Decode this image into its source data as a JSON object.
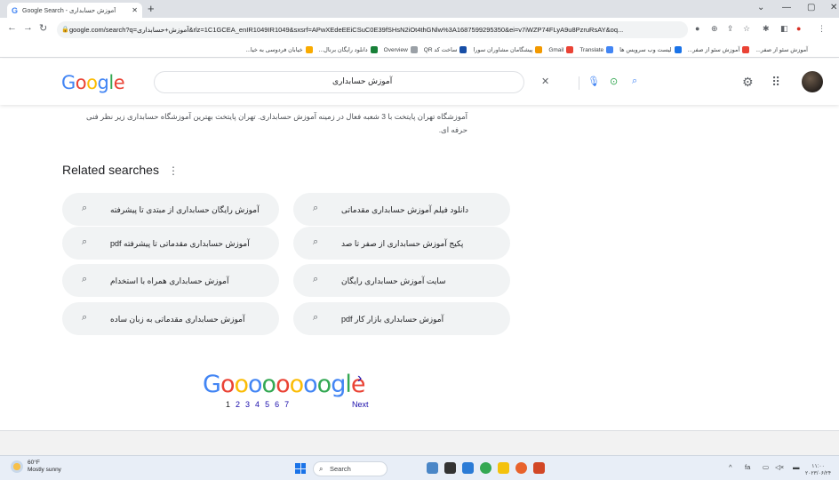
{
  "browser": {
    "tab_icon": "G",
    "tab_title": "Google Search - آموزش حسابداری",
    "url": "google.com/search?q=آموزش+حسابداری&rlz=1C1GCEA_enIR1049IR1049&sxsrf=APwXEdeEEiCSuC0E39fSHsN2iOt4thGNlw%3A1687599295350&ei=v7iWZP74FLyA9u8PzruRsAY&oq...",
    "bookmarks": [
      {
        "label": "آموزش سئو از صفر...",
        "color": "#ffffff"
      },
      {
        "label": "آموزش سئو از صفر...",
        "color": "#ea4335"
      },
      {
        "label": "لیست وب سرویس ها",
        "color": "#1a73e8"
      },
      {
        "label": "Translate",
        "color": "#4285f4"
      },
      {
        "label": "Gmail",
        "color": "#ea4335"
      },
      {
        "label": "پیشگامان مشاوران سورا",
        "color": "#f29900"
      },
      {
        "label": "ساخت کد QR",
        "color": "#174ea6"
      },
      {
        "label": "Overview",
        "color": "#9aa0a6"
      },
      {
        "label": "دانلود رایگان برنال...",
        "color": "#188038"
      },
      {
        "label": "خیابان فردوسی به خیا...",
        "color": "#f9ab00"
      }
    ]
  },
  "header": {
    "logo": "Google",
    "query": "آموزش حسابداری"
  },
  "snippet": {
    "line1": "آموزشگاه تهران پایتخت با 3 شعبه فعال در زمینه آموزش حسابداری. تهران پایتخت بهترین آموزشگاه حسابداری زیر نظر فنی",
    "line2": "حرفه ای."
  },
  "related": {
    "title": "Related searches",
    "chips": [
      {
        "text": "آموزش رایگان حسابداری از مبتدی تا پیشرفته"
      },
      {
        "text": "دانلود فیلم آموزش حسابداری مقدماتی"
      },
      {
        "text": "آموزش حسابداری مقدماتی تا پیشرفته pdf"
      },
      {
        "text": "پکیج آموزش حسابداری از صفر تا صد"
      },
      {
        "text": "آموزش حسابداری همراه با استخدام"
      },
      {
        "text": "سایت آموزش حسابداری رایگان"
      },
      {
        "text": "آموزش حسابداری مقدماتی به زبان ساده"
      },
      {
        "text": "آموزش حسابداری بازار کار pdf"
      }
    ]
  },
  "pager": {
    "logo_letters": "Goooooooogle",
    "pages": [
      "1",
      "2",
      "3",
      "4",
      "5",
      "6",
      "7"
    ],
    "next": "Next"
  },
  "taskbar": {
    "weather_temp": "60°F",
    "weather_desc": "Mostly sunny",
    "search_label": "Search",
    "clock_time": "۱۱:۰۰",
    "clock_date": "۲۰۲۳/۰۶/۲۴"
  }
}
